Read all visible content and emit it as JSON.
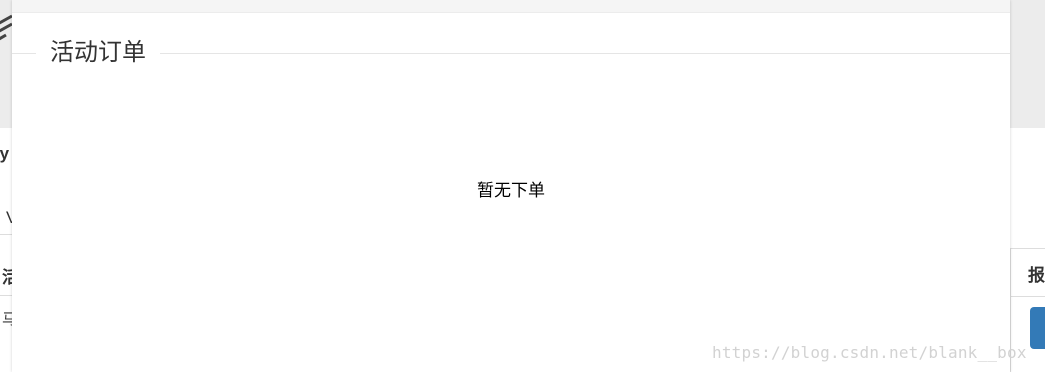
{
  "background": {
    "fragments": {
      "row1": "ty",
      "row2": "V",
      "table_header_left": "活",
      "table_cell_left": "马",
      "table_header_right": "报"
    },
    "button_color": "#337ab7"
  },
  "modal": {
    "title": "活动订单",
    "empty_message": "暂无下单"
  },
  "watermark": "https://blog.csdn.net/blank__box"
}
